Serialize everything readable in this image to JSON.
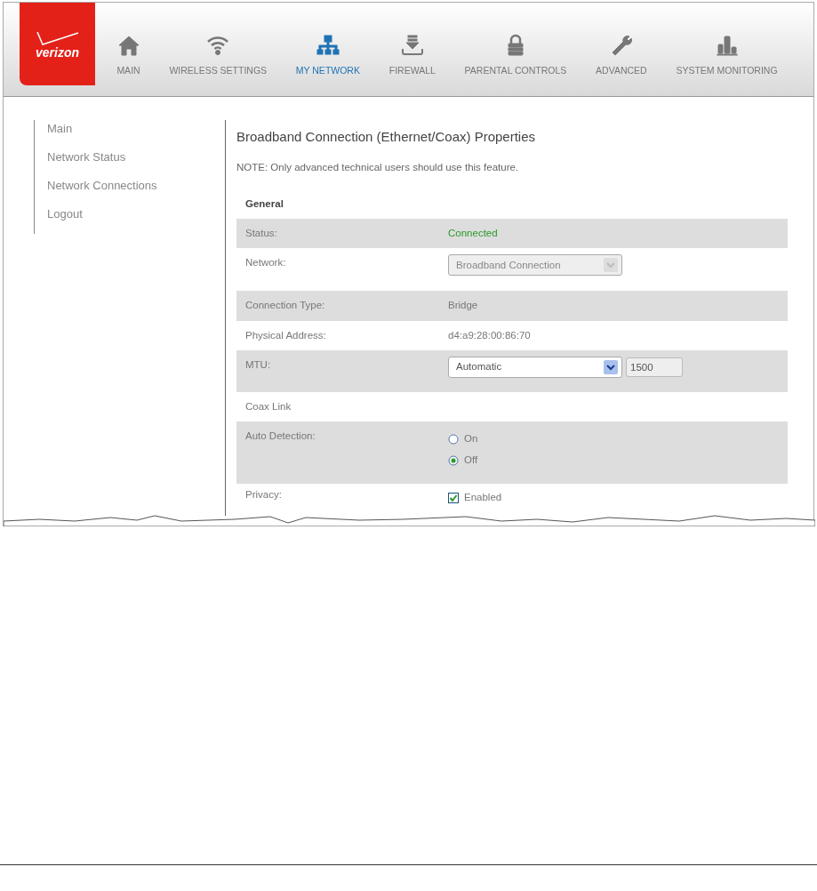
{
  "logo": {
    "text": "verizon"
  },
  "nav": [
    {
      "label": "MAIN",
      "selected": false
    },
    {
      "label": "WIRELESS SETTINGS",
      "selected": false
    },
    {
      "label": "MY NETWORK",
      "selected": true
    },
    {
      "label": "FIREWALL",
      "selected": false
    },
    {
      "label": "PARENTAL CONTROLS",
      "selected": false
    },
    {
      "label": "ADVANCED",
      "selected": false
    },
    {
      "label": "SYSTEM MONITORING",
      "selected": false
    }
  ],
  "sidebar": {
    "items": [
      "Main",
      "Network Status",
      "Network Connections",
      "Logout"
    ]
  },
  "title": "Broadband Connection (Ethernet/Coax) Properties",
  "note": "NOTE: Only advanced technical users should use this feature.",
  "rows": [
    {
      "kind": "heading",
      "label": "General"
    },
    {
      "kind": "status",
      "label": "Status:",
      "value": "Connected"
    },
    {
      "kind": "select",
      "label": "Network:",
      "value": "Broadband Connection",
      "disabled": true
    },
    {
      "kind": "text",
      "label": "Connection Type:",
      "value": "Bridge"
    },
    {
      "kind": "text",
      "label": "Physical Address:",
      "value": "d4:a9:28:00:86:70"
    },
    {
      "kind": "select_input",
      "label": "MTU:",
      "value": "Automatic",
      "disabled": false,
      "input_value": "1500"
    },
    {
      "kind": "subheading",
      "label": "Coax Link"
    },
    {
      "kind": "radios",
      "label": "Auto Detection:",
      "options": [
        {
          "label": "On",
          "selected": false
        },
        {
          "label": "Off",
          "selected": true
        }
      ]
    },
    {
      "kind": "checkbox",
      "label": "Privacy:",
      "checkbox_label": "Enabled",
      "checked": true
    }
  ]
}
